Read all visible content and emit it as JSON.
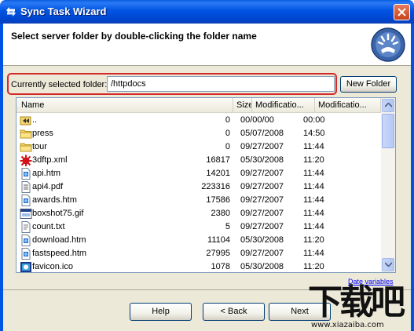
{
  "window": {
    "title": "Sync Task Wizard"
  },
  "header": {
    "instruction": "Select server folder by double-clicking the folder name"
  },
  "folder": {
    "label": "Currently selected folder:",
    "value": "/httpdocs",
    "new_folder_label": "New Folder"
  },
  "list": {
    "columns": [
      "Name",
      "Size",
      "Modificatio...",
      "Modificatio..."
    ],
    "rows": [
      {
        "icon": "parent-folder-icon",
        "name": "..",
        "size": "0",
        "date": "00/00/00",
        "time": "00:00"
      },
      {
        "icon": "folder-icon",
        "name": "press",
        "size": "0",
        "date": "05/07/2008",
        "time": "14:50"
      },
      {
        "icon": "folder-icon",
        "name": "tour",
        "size": "0",
        "date": "09/27/2007",
        "time": "11:44"
      },
      {
        "icon": "3dftp-file-icon",
        "name": "3dftp.xml",
        "size": "16817",
        "date": "05/30/2008",
        "time": "11:20"
      },
      {
        "icon": "html-file-icon",
        "name": "api.htm",
        "size": "14201",
        "date": "09/27/2007",
        "time": "11:44"
      },
      {
        "icon": "pdf-file-icon",
        "name": "api4.pdf",
        "size": "223316",
        "date": "09/27/2007",
        "time": "11:44"
      },
      {
        "icon": "html-file-icon",
        "name": "awards.htm",
        "size": "17586",
        "date": "09/27/2007",
        "time": "11:44"
      },
      {
        "icon": "gif-file-icon",
        "name": "boxshot75.gif",
        "size": "2380",
        "date": "09/27/2007",
        "time": "11:44"
      },
      {
        "icon": "text-file-icon",
        "name": "count.txt",
        "size": "5",
        "date": "09/27/2007",
        "time": "11:44"
      },
      {
        "icon": "html-file-icon",
        "name": "download.htm",
        "size": "11104",
        "date": "05/30/2008",
        "time": "11:20"
      },
      {
        "icon": "html-file-icon",
        "name": "fastspeed.htm",
        "size": "27995",
        "date": "09/27/2007",
        "time": "11:44"
      },
      {
        "icon": "ico-file-icon",
        "name": "favicon.ico",
        "size": "1078",
        "date": "05/30/2008",
        "time": "11:20"
      }
    ]
  },
  "links": {
    "date_variables": "Date variables"
  },
  "buttons": {
    "help": "Help",
    "back": "< Back",
    "next": "Next"
  },
  "watermark": {
    "main": "下载吧",
    "sub": "www.xiazaiba.com"
  },
  "colors": {
    "titlebar": "#0054e3",
    "highlight_border": "#d62a2a",
    "dialog_bg": "#ece9d8",
    "link": "#0000ff"
  }
}
